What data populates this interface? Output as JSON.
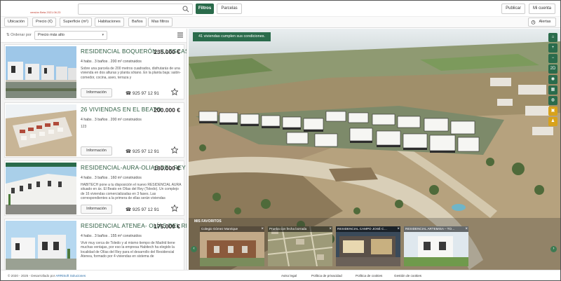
{
  "header": {
    "version": "versión Beta 2021.06.23",
    "search_placeholder": "",
    "filters_label": "Filtros",
    "parcels_label": "Parcelas",
    "publish_label": "Publicar",
    "account_label": "Mi cuenta"
  },
  "filterbar": {
    "items": [
      "Ubicación",
      "Precio (€)",
      "Superficie (m²)",
      "Habitaciones",
      "Baños",
      "Mas filtros"
    ],
    "alerts_label": "Alertas"
  },
  "sort": {
    "label": "Ordenar por",
    "value": "Precio más alto"
  },
  "listings": [
    {
      "title": "RESIDENCIAL BOQUERÓN- ILLESCAS",
      "price": "235.000 €",
      "specs": "4 habs . 3 baños . 200 m² construidos",
      "desc": "Sobre una parcela de 200 metros cuadrados, disfrutarás de una vivienda en dos alturas y planta sótano. En la planta baja: salón-comedor, cocina, aseo, terraza y",
      "info_label": "Información",
      "phone": "925 97 12 91"
    },
    {
      "title": "26 VIVIENDAS EN EL BEATO",
      "price": "200.000 €",
      "specs": "4 habs . 3 baños . 200 m² construidos",
      "desc": "123",
      "info_label": "Información",
      "phone": "925 97 12 91"
    },
    {
      "title": "RESIDENCIAL-AURA-OLIAS DEL REY",
      "price": "180.000 €",
      "specs": "4 habs . 3 baños . 160 m² construidos",
      "desc": "HABITECH pone a tu disposición el nuevo RESIDENCIAL AURA situado en áx. El Beato en Olías del Rey (Toledo). Un complejo de 16 viviendas comercializadas en 3 fases. Las correspondientes a la primera de ellas serán viviendas",
      "info_label": "Información",
      "phone": "925 97 12 91"
    },
    {
      "title": "RESIDENCIAL ATENEA- OLÍAS DEL REY",
      "price": "175.000 €",
      "specs": "4 habs . 3 baños . 155 m² construidos",
      "desc": "Vivir muy cerca de Toledo y al mismo tiempo de Madrid tiene muchas ventajas, por eso la empresa Habitech ha elegido la localidad de Olías del Rey para el desarrollo del Residencial Atenea, formado por 4 viviendas en sistema de",
      "info_label": "Información",
      "phone": "925 97 12 91"
    }
  ],
  "map": {
    "results_text": "41 viviendas cumplen sus condiciones.",
    "controls": [
      "⌂",
      "+",
      "−",
      "2D",
      "◉",
      "▦",
      "◍",
      "▣",
      "♟"
    ],
    "favorites_title": "MIS FAVORITOS",
    "favorites": [
      "Colegio Gómez Manrique",
      "Prueba con fecha borrada",
      "RESIDENCIAL CAMPO JOSÉ C…",
      "RESIDENCIAL ARTEMISA – TO…"
    ]
  },
  "footer": {
    "copyright": "© 2020 - 2025 - Desarrollado por",
    "developer": "ARRISoft Soluciones",
    "links": [
      "Aviso legal",
      "Política de privacidad",
      "Política de cookies",
      "Gestión de cookies"
    ]
  },
  "colors": {
    "brand_green": "#2a6b4b",
    "title_green": "#2a5a3e",
    "accent_yellow": "#d8a21b"
  }
}
